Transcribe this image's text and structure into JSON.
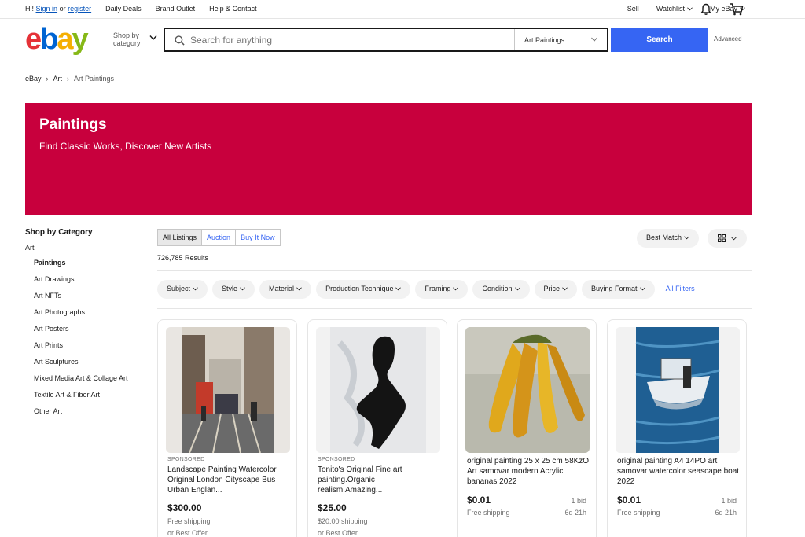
{
  "topbar": {
    "greeting_prefix": "Hi!",
    "sign_in": "Sign in",
    "or": "or",
    "register": "register",
    "links": [
      "Daily Deals",
      "Brand Outlet",
      "Help & Contact"
    ],
    "sell": "Sell",
    "watchlist": "Watchlist",
    "my_ebay": "My eBay"
  },
  "header": {
    "logo": {
      "e": "e",
      "b": "b",
      "a": "a",
      "y": "y"
    },
    "shop_by_line1": "Shop by",
    "shop_by_line2": "category",
    "search_placeholder": "Search for anything",
    "search_category": "Art Paintings",
    "search_button": "Search",
    "advanced": "Advanced"
  },
  "breadcrumb": [
    "eBay",
    "Art",
    "Art Paintings"
  ],
  "hero": {
    "title": "Paintings",
    "subtitle": "Find Classic Works, Discover New Artists",
    "color": "#c8003d"
  },
  "sidebar": {
    "heading": "Shop by Category",
    "root": "Art",
    "items": [
      "Paintings",
      "Art Drawings",
      "Art NFTs",
      "Art Photographs",
      "Art Posters",
      "Art Prints",
      "Art Sculptures",
      "Mixed Media Art & Collage Art",
      "Textile Art & Fiber Art",
      "Other Art"
    ]
  },
  "listing": {
    "toggles": [
      "All Listings",
      "Auction",
      "Buy It Now"
    ],
    "results": "726,785 Results",
    "sort": "Best Match",
    "filters": [
      "Subject",
      "Style",
      "Material",
      "Production Technique",
      "Framing",
      "Condition",
      "Price",
      "Buying Format"
    ],
    "all_filters": "All Filters"
  },
  "cards": [
    {
      "sponsored": "SPONSORED",
      "title": "Landscape Painting Watercolor Original London Cityscape Bus Urban Englan...",
      "price": "$300.00",
      "shipping": "Free shipping",
      "offer": "or Best Offer"
    },
    {
      "sponsored": "SPONSORED",
      "title": "Tonito's Original Fine art painting.Organic realism.Amazing...",
      "price": "$25.00",
      "shipping": "$20.00 shipping",
      "offer": "or Best Offer"
    },
    {
      "title": "original painting 25 x 25 cm 58KzO Art samovar modern Acrylic bananas 2022",
      "price": "$0.01",
      "bids": "1 bid",
      "shipping": "Free shipping",
      "time": "6d 21h"
    },
    {
      "title": "original painting A4 14PO art samovar watercolor seascape boat 2022",
      "price": "$0.01",
      "bids": "1 bid",
      "shipping": "Free shipping",
      "time": "6d 21h"
    }
  ],
  "colors": {
    "accent": "#3665f3",
    "link": "#0654ba"
  }
}
